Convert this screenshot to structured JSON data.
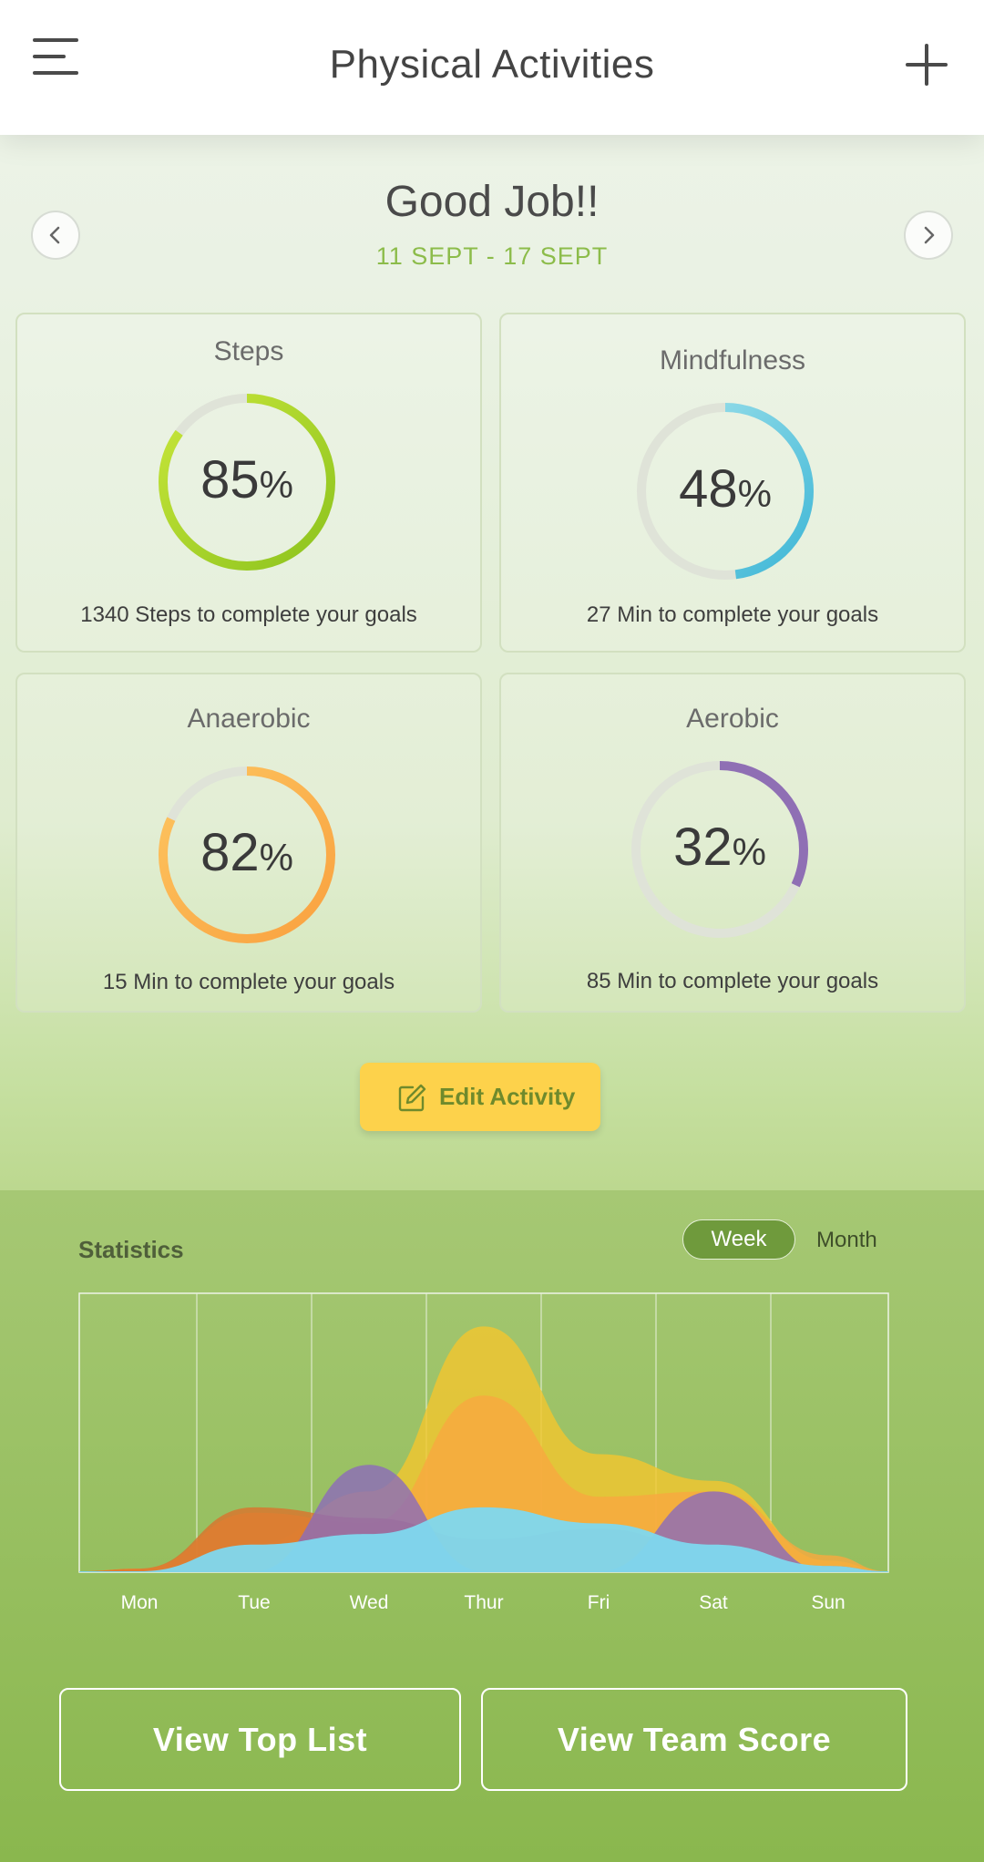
{
  "header": {
    "title": "Physical Activities",
    "menu_icon": "hamburger-menu-icon",
    "add_icon": "plus-icon"
  },
  "summary": {
    "greeting": "Good Job!!",
    "date_range": "11 SEPT - 17 SEPT",
    "prev_icon": "chevron-left-icon",
    "next_icon": "chevron-right-icon"
  },
  "cards": [
    {
      "title": "Steps",
      "percent": 85,
      "unit": "%",
      "note": "1340 Steps to complete your goals",
      "color_start": "#8cc31e",
      "color_end": "#c8e63a"
    },
    {
      "title": "Mindfulness",
      "percent": 48,
      "unit": "%",
      "note": "27 Min to complete your goals",
      "color_start": "#3db6d6",
      "color_end": "#a3e3ec"
    },
    {
      "title": "Anaerobic",
      "percent": 82,
      "unit": "%",
      "note": "15 Min to complete your goals",
      "color_start": "#f9a13f",
      "color_end": "#fdc560"
    },
    {
      "title": "Aerobic",
      "percent": 32,
      "unit": "%",
      "note": "85 Min to complete your goals",
      "color_start": "#8f6fb4",
      "color_end": "#8f6fb4"
    }
  ],
  "edit_button": {
    "label": "Edit Activity",
    "icon": "edit-pencil-icon",
    "color": "#fdd24b"
  },
  "statistics": {
    "title": "Statistics",
    "tabs": [
      {
        "label": "Week",
        "active": true
      },
      {
        "label": "Month",
        "active": false
      }
    ]
  },
  "chart_data": {
    "type": "area",
    "categories": [
      "Mon",
      "Tue",
      "Wed",
      "Thur",
      "Fri",
      "Sat",
      "Sun"
    ],
    "ylim": [
      0,
      100
    ],
    "grid": true,
    "series": [
      {
        "color": "#f2c62f",
        "values": [
          1,
          10,
          30,
          92,
          44,
          34,
          4
        ]
      },
      {
        "color": "#f8a840",
        "values": [
          1,
          22,
          18,
          66,
          28,
          30,
          6
        ]
      },
      {
        "color": "#d9742e",
        "values": [
          1,
          24,
          20,
          12,
          16,
          8,
          2
        ]
      },
      {
        "color": "#8c6cb8",
        "values": [
          0,
          0,
          40,
          0,
          0,
          30,
          0
        ]
      },
      {
        "color": "#7ed8ef",
        "values": [
          0,
          10,
          14,
          24,
          18,
          10,
          2
        ]
      }
    ]
  },
  "actions": {
    "top_list": "View Top List",
    "team_score": "View Team Score"
  }
}
